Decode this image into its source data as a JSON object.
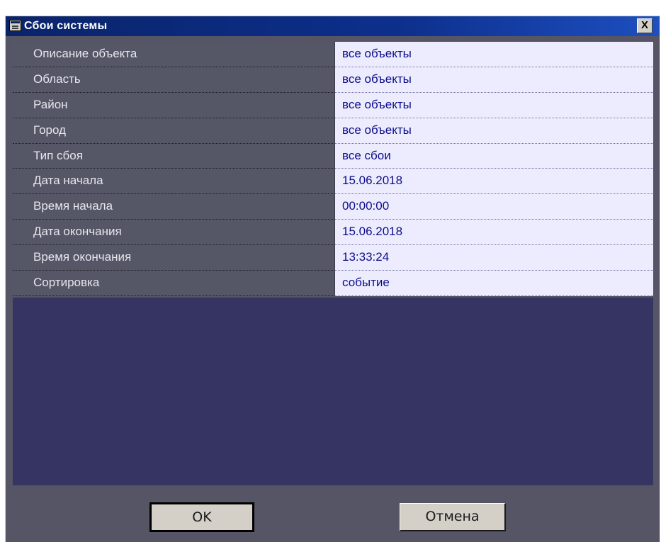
{
  "window": {
    "title": "Сбои системы",
    "close_label": "X"
  },
  "properties": [
    {
      "label": "Описание объекта",
      "value": "все объекты"
    },
    {
      "label": "Область",
      "value": "все объекты"
    },
    {
      "label": "Район",
      "value": "все объекты"
    },
    {
      "label": "Город",
      "value": "все объекты"
    },
    {
      "label": "Тип сбоя",
      "value": "все сбои"
    },
    {
      "label": "Дата начала",
      "value": "15.06.2018"
    },
    {
      "label": "Время начала",
      "value": "00:00:00"
    },
    {
      "label": "Дата окончания",
      "value": "15.06.2018"
    },
    {
      "label": "Время окончания",
      "value": "13:33:24"
    },
    {
      "label": "Сортировка",
      "value": "событие"
    }
  ],
  "buttons": {
    "ok": "OK",
    "cancel": "Отмена"
  }
}
